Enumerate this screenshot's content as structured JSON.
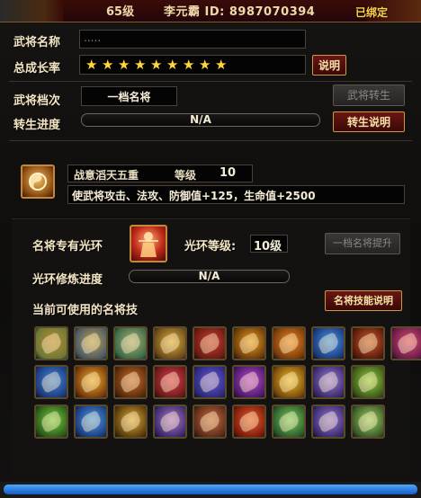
{
  "header": {
    "level": "65级",
    "id_text": "李元霸 ID: 8987070394",
    "bound_label": "已绑定"
  },
  "general": {
    "name_label": "武将名称",
    "name_value": ".....",
    "growth_label": "总成长率",
    "stars": [
      "★",
      "★",
      "★",
      "★",
      "★",
      "★",
      "★",
      "★",
      "★"
    ],
    "explain_label": "说明",
    "rank_label": "武将档次",
    "rank_value": "一档名将",
    "rebirth_button": "武将转生",
    "rebirth_progress_label": "转生进度",
    "rebirth_progress_text": "N/A",
    "rebirth_explain_button": "转生说明"
  },
  "buff": {
    "name": "战意滔天五重",
    "level_label": "等级",
    "level_value": "10",
    "description": "使武将攻击、法攻、防御值+125，生命值+2500"
  },
  "aura": {
    "title": "名将专有光环",
    "level_label": "光环等级:",
    "level_value": "10级",
    "upgrade_button": "一档名将提升",
    "training_label": "光环修炼进度",
    "training_text": "N/A",
    "skills_label": "当前可使用的名将技",
    "skills_explain_button": "名将技能说明"
  },
  "skills": [
    [
      "skill-1",
      "#6a7a3a",
      "#c08a2a"
    ],
    [
      "skill-2",
      "#4a5a6a",
      "#c0a04a"
    ],
    [
      "skill-3",
      "#3a6a4a",
      "#b0b070"
    ],
    [
      "skill-4",
      "#6a4a1a",
      "#e0b040"
    ],
    [
      "skill-5",
      "#6a1a14",
      "#d04030"
    ],
    [
      "skill-6",
      "#6a3a0a",
      "#f0a020"
    ],
    [
      "skill-7",
      "#7a3a0a",
      "#f08a20"
    ],
    [
      "skill-8",
      "#1a3a7a",
      "#4a9af0"
    ],
    [
      "skill-9",
      "#5a1a0a",
      "#d06030"
    ],
    [
      "skill-10",
      "#6a1a4a",
      "#e05070"
    ],
    [
      "skill-11",
      "#1a3a7a",
      "#4a8ae0"
    ],
    [
      "skill-12",
      "#7a3a0a",
      "#f0b030"
    ],
    [
      "skill-13",
      "#5a2a0a",
      "#d07030"
    ],
    [
      "skill-14",
      "#6a1a1a",
      "#e04050"
    ],
    [
      "skill-15",
      "#2a2a7a",
      "#6a5ae0"
    ],
    [
      "skill-16",
      "#4a1a6a",
      "#c04ad0"
    ],
    [
      "skill-17",
      "#7a4a0a",
      "#f0c030"
    ],
    [
      "skill-18",
      "#3a2a6a",
      "#a080e0"
    ],
    [
      "skill-19",
      "#3a5a1a",
      "#9ad040"
    ],
    [
      "skill-20",
      "#2a5a1a",
      "#7ad040"
    ],
    [
      "skill-21",
      "#1a3a7a",
      "#50a0f0"
    ],
    [
      "skill-22",
      "#5a3a0a",
      "#e0b040"
    ],
    [
      "skill-23",
      "#3a2a6a",
      "#b07ad0"
    ],
    [
      "skill-24",
      "#5a2a1a",
      "#d07040"
    ],
    [
      "skill-25",
      "#7a1a0a",
      "#f06030"
    ],
    [
      "skill-26",
      "#2a5a2a",
      "#80d060"
    ],
    [
      "skill-27",
      "#3a2a6a",
      "#9a7ae0"
    ],
    [
      "skill-28",
      "#3a5a2a",
      "#a0d060"
    ]
  ],
  "colors": {
    "header_bg": "#3a0c08",
    "gold_text": "#f0d9a8",
    "bound_yellow": "#ffd24a",
    "button_red": "#6a1612",
    "star_yellow": "#ffd83a"
  }
}
